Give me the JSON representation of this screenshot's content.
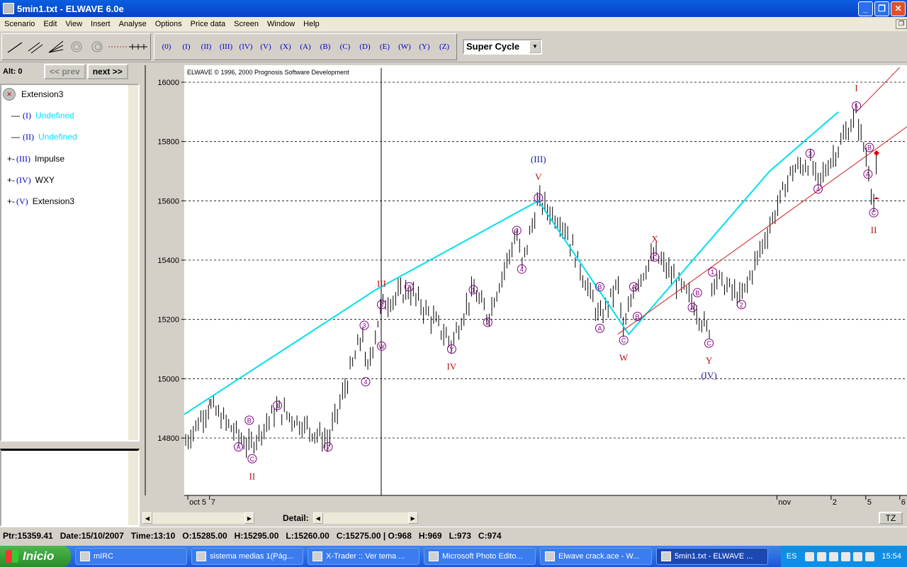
{
  "window": {
    "title": "5min1.txt - ELWAVE 6.0e",
    "buttons": [
      "_",
      "❐",
      "✕"
    ]
  },
  "menu": [
    "Scenario",
    "Edit",
    "View",
    "Insert",
    "Analyse",
    "Options",
    "Price data",
    "Screen",
    "Window",
    "Help"
  ],
  "toolbar": {
    "wave_buttons": [
      "(0)",
      "(I)",
      "(II)",
      "(III)",
      "(IV)",
      "(V)",
      "(X)",
      "(A)",
      "(B)",
      "(C)",
      "(D)",
      "(E)",
      "(W)",
      "(Y)",
      "(Z)"
    ],
    "degree_select": "Super Cycle"
  },
  "left": {
    "alt_label": "Alt: 0",
    "prev_label": "<< prev",
    "next_label": "next >>",
    "tree": [
      {
        "label": "Extension3",
        "wave": ""
      },
      {
        "label": "Undefined",
        "wave": "(I)"
      },
      {
        "label": "Undefined",
        "wave": "(II)"
      },
      {
        "label": "Impulse",
        "wave": "(III)"
      },
      {
        "label": "WXY",
        "wave": "(IV)"
      },
      {
        "label": "Extension3",
        "wave": "(V)"
      }
    ]
  },
  "chart_data": {
    "type": "bar",
    "copyright": "ELWAVE © 1996, 2000 Prognosis Software Development",
    "y_ticks": [
      14800,
      15000,
      15200,
      15400,
      15600,
      15800,
      16000
    ],
    "ylim": [
      14620,
      16060
    ],
    "x_ticks": [
      "oct 5",
      "7",
      "nov",
      "2",
      "5",
      "6"
    ],
    "grid": "horizontal dashed",
    "colors": {
      "ohlc": "#000000",
      "channel": "#00e0f0",
      "trendline": "#d02020",
      "labels_minor": "#800080",
      "labels_major": "#c01010",
      "labels_super": "#1a1aa0"
    },
    "channel_line": [
      [
        0,
        14880
      ],
      [
        0.265,
        15300
      ],
      [
        0.49,
        15600
      ],
      [
        0.615,
        15150
      ],
      [
        0.81,
        15700
      ],
      [
        0.905,
        15900
      ]
    ],
    "wave_labels": [
      {
        "t": "I",
        "x": 0.035,
        "y": 14920,
        "level": "major"
      },
      {
        "t": "A",
        "x": 0.075,
        "y": 14770,
        "level": "minor"
      },
      {
        "t": "B",
        "x": 0.09,
        "y": 14860,
        "level": "minor"
      },
      {
        "t": "C",
        "x": 0.094,
        "y": 14730,
        "level": "minor"
      },
      {
        "t": "II",
        "x": 0.094,
        "y": 14670,
        "level": "major"
      },
      {
        "t": "1",
        "x": 0.129,
        "y": 14910,
        "level": "minor"
      },
      {
        "t": "2",
        "x": 0.199,
        "y": 14770,
        "level": "minor"
      },
      {
        "t": "3",
        "x": 0.249,
        "y": 15180,
        "level": "minor"
      },
      {
        "t": "4",
        "x": 0.251,
        "y": 14990,
        "level": "minor"
      },
      {
        "t": "W",
        "x": 0.273,
        "y": 15110,
        "level": "minor"
      },
      {
        "t": "5",
        "x": 0.273,
        "y": 15250,
        "level": "minor"
      },
      {
        "t": "III",
        "x": 0.273,
        "y": 15320,
        "level": "major"
      },
      {
        "t": "X",
        "x": 0.311,
        "y": 15310,
        "level": "minor"
      },
      {
        "t": "Y",
        "x": 0.37,
        "y": 15100,
        "level": "minor"
      },
      {
        "t": "IV",
        "x": 0.37,
        "y": 15040,
        "level": "major"
      },
      {
        "t": "1",
        "x": 0.4,
        "y": 15300,
        "level": "minor"
      },
      {
        "t": "2",
        "x": 0.42,
        "y": 15190,
        "level": "minor"
      },
      {
        "t": "3",
        "x": 0.46,
        "y": 15500,
        "level": "minor"
      },
      {
        "t": "4",
        "x": 0.467,
        "y": 15370,
        "level": "minor"
      },
      {
        "t": "5",
        "x": 0.49,
        "y": 15610,
        "level": "minor"
      },
      {
        "t": "V",
        "x": 0.49,
        "y": 15680,
        "level": "major"
      },
      {
        "t": "(III)",
        "x": 0.49,
        "y": 15740,
        "level": "super"
      },
      {
        "t": "A",
        "x": 0.575,
        "y": 15170,
        "level": "minor"
      },
      {
        "t": "B",
        "x": 0.575,
        "y": 15310,
        "level": "minor"
      },
      {
        "t": "C",
        "x": 0.608,
        "y": 15130,
        "level": "minor"
      },
      {
        "t": "W",
        "x": 0.608,
        "y": 15070,
        "level": "major"
      },
      {
        "t": "A",
        "x": 0.622,
        "y": 15310,
        "level": "minor"
      },
      {
        "t": "B",
        "x": 0.627,
        "y": 15210,
        "level": "minor"
      },
      {
        "t": "C",
        "x": 0.651,
        "y": 15410,
        "level": "minor"
      },
      {
        "t": "X",
        "x": 0.651,
        "y": 15470,
        "level": "major"
      },
      {
        "t": "A",
        "x": 0.703,
        "y": 15240,
        "level": "minor"
      },
      {
        "t": "B",
        "x": 0.71,
        "y": 15290,
        "level": "minor"
      },
      {
        "t": "C",
        "x": 0.726,
        "y": 15120,
        "level": "minor"
      },
      {
        "t": "Y",
        "x": 0.726,
        "y": 15060,
        "level": "major"
      },
      {
        "t": "(IV)",
        "x": 0.726,
        "y": 15010,
        "level": "super"
      },
      {
        "t": "1",
        "x": 0.731,
        "y": 15360,
        "level": "minor"
      },
      {
        "t": "2",
        "x": 0.771,
        "y": 15250,
        "level": "minor"
      },
      {
        "t": "3",
        "x": 0.866,
        "y": 15760,
        "level": "minor"
      },
      {
        "t": "4",
        "x": 0.877,
        "y": 15640,
        "level": "minor"
      },
      {
        "t": "5",
        "x": 0.93,
        "y": 15920,
        "level": "minor"
      },
      {
        "t": "I",
        "x": 0.93,
        "y": 15980,
        "level": "major"
      },
      {
        "t": "B",
        "x": 0.948,
        "y": 15780,
        "level": "minor"
      },
      {
        "t": "A",
        "x": 0.946,
        "y": 15690,
        "level": "minor"
      },
      {
        "t": "C",
        "x": 0.954,
        "y": 15560,
        "level": "minor"
      },
      {
        "t": "II",
        "x": 0.954,
        "y": 15500,
        "level": "major"
      }
    ]
  },
  "bottom": {
    "detail_label": "Detail:",
    "tz_label": "TZ"
  },
  "status": {
    "ptr": "Ptr:15359.41",
    "date": "Date:15/10/2007",
    "time": "Time:13:10",
    "open": "O:15285.00",
    "high": "H:15295.00",
    "low": "L:15260.00",
    "close": "C:15275.00 | O:968",
    "h2": "H:969",
    "l2": "L:973",
    "c2": "C:974"
  },
  "taskbar": {
    "start": "Inicio",
    "tasks": [
      "mIRC",
      "sistema medias 1(Pág...",
      "X-Trader :: Ver tema ...",
      "Microsoft Photo Edito...",
      "Elwave crack.ace - W...",
      "5min1.txt - ELWAVE ..."
    ],
    "lang": "ES",
    "clock": "15:54"
  }
}
